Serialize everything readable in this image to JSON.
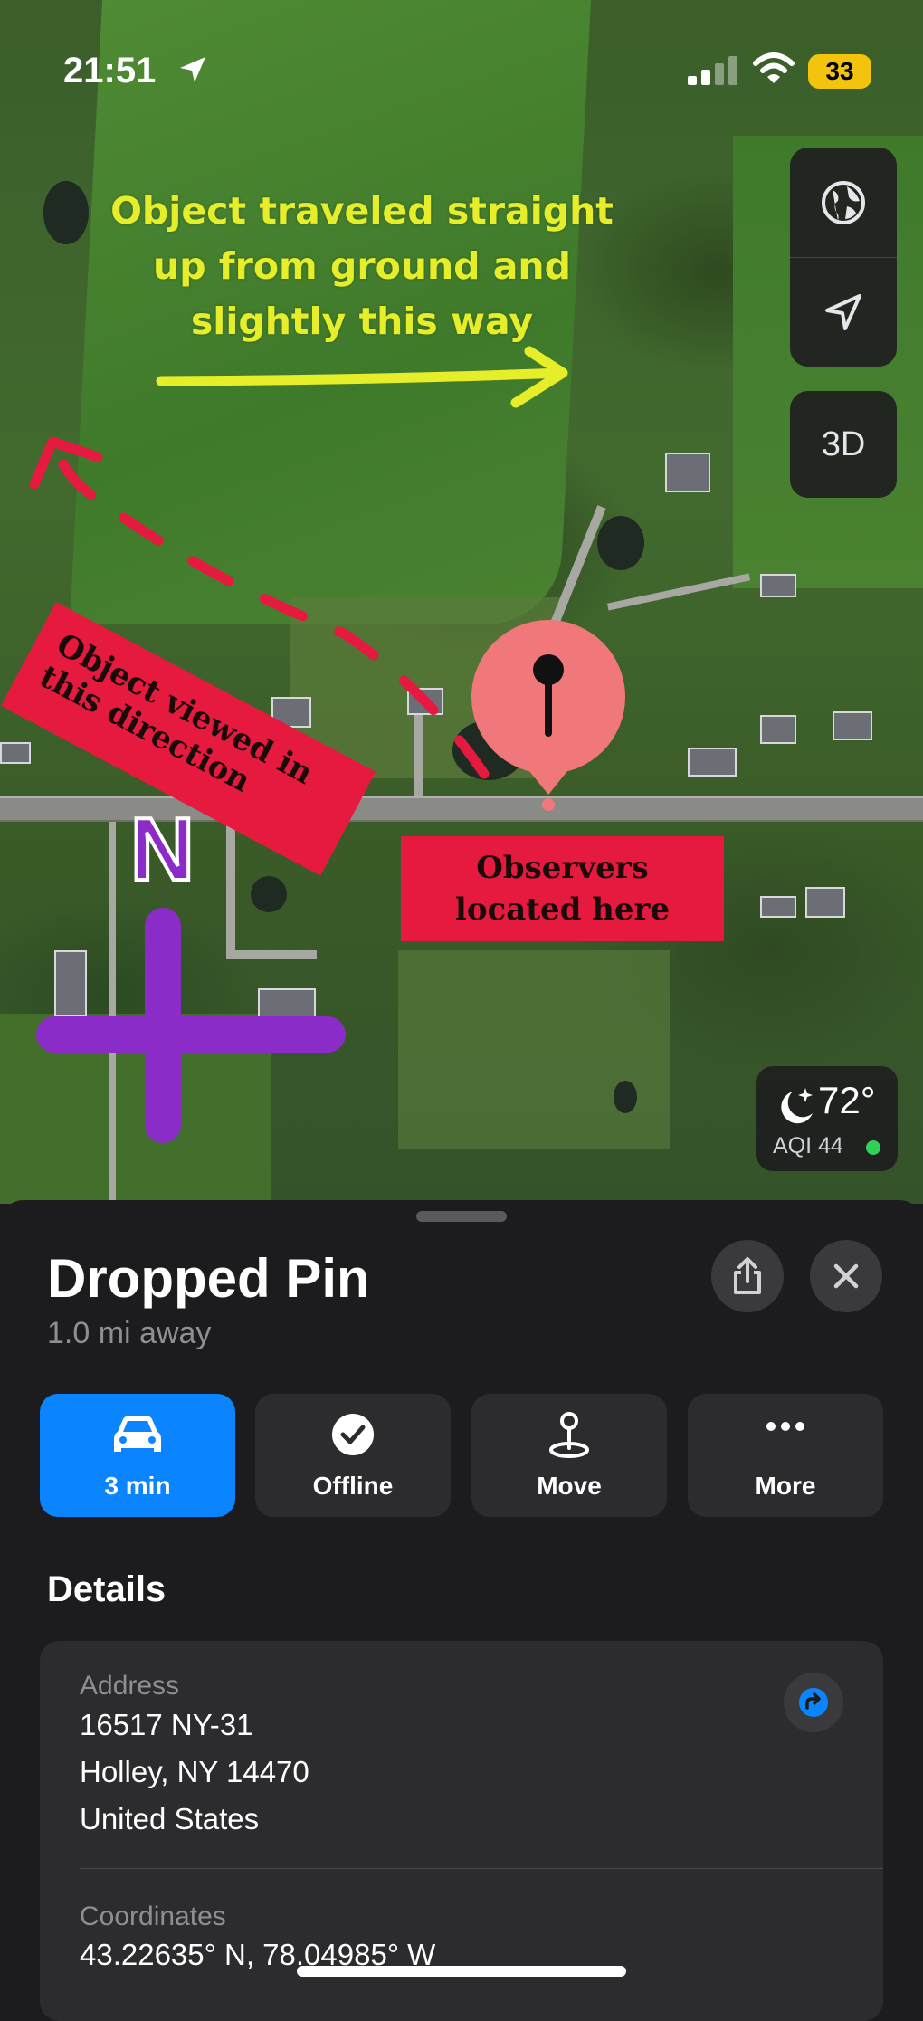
{
  "status_bar": {
    "time": "21:51",
    "battery": "33"
  },
  "map": {
    "controls": {
      "globe_icon": "globe-icon",
      "location_icon": "location-arrow-icon",
      "btn_3d": "3D"
    },
    "weather": {
      "temp": "72°",
      "aqi": "AQI 44",
      "aqi_color": "#30d158"
    },
    "annotations": {
      "yellow_line1": "Object traveled straight",
      "yellow_line2": "up from ground and",
      "yellow_line3": "slightly this way",
      "red1_line1": "Object viewed in",
      "red1_line2": "this direction",
      "red2_line1": "Observers",
      "red2_line2": "located here",
      "north": "N"
    },
    "colors": {
      "yellow": "#e6ee2a",
      "red": "#e51a3e",
      "purple": "#8b2bc8",
      "pin": "#f0787a"
    }
  },
  "sheet": {
    "title": "Dropped Pin",
    "subtitle": "1.0 mi away",
    "actions": [
      {
        "label": "3 min",
        "icon": "car-icon"
      },
      {
        "label": "Offline",
        "icon": "checkmark-circle-icon"
      },
      {
        "label": "Move",
        "icon": "pin-move-icon"
      },
      {
        "label": "More",
        "icon": "ellipsis-icon"
      }
    ],
    "details_heading": "Details",
    "address_label": "Address",
    "address_line1": "16517 NY-31",
    "address_line2": "Holley, NY  14470",
    "address_line3": "United States",
    "coordinates_label": "Coordinates",
    "coordinates_value": "43.22635° N, 78.04985° W",
    "accent": "#0a84ff"
  }
}
